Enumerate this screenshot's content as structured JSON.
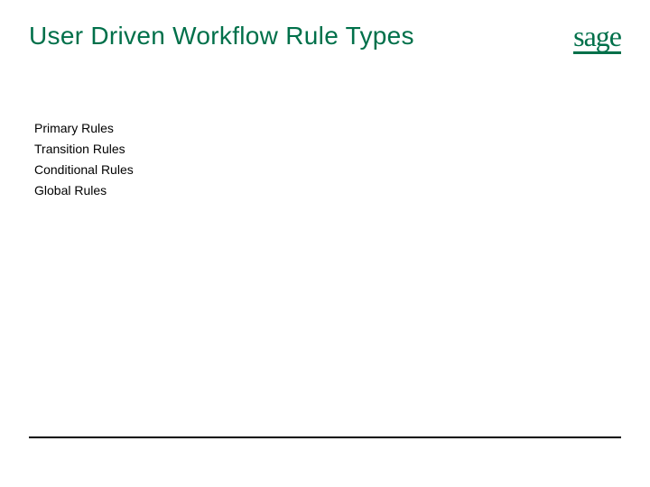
{
  "title": "User Driven Workflow Rule Types",
  "logo": {
    "text": "sage"
  },
  "rules": {
    "items": [
      "Primary Rules",
      "Transition Rules",
      "Conditional Rules",
      "Global Rules"
    ]
  }
}
